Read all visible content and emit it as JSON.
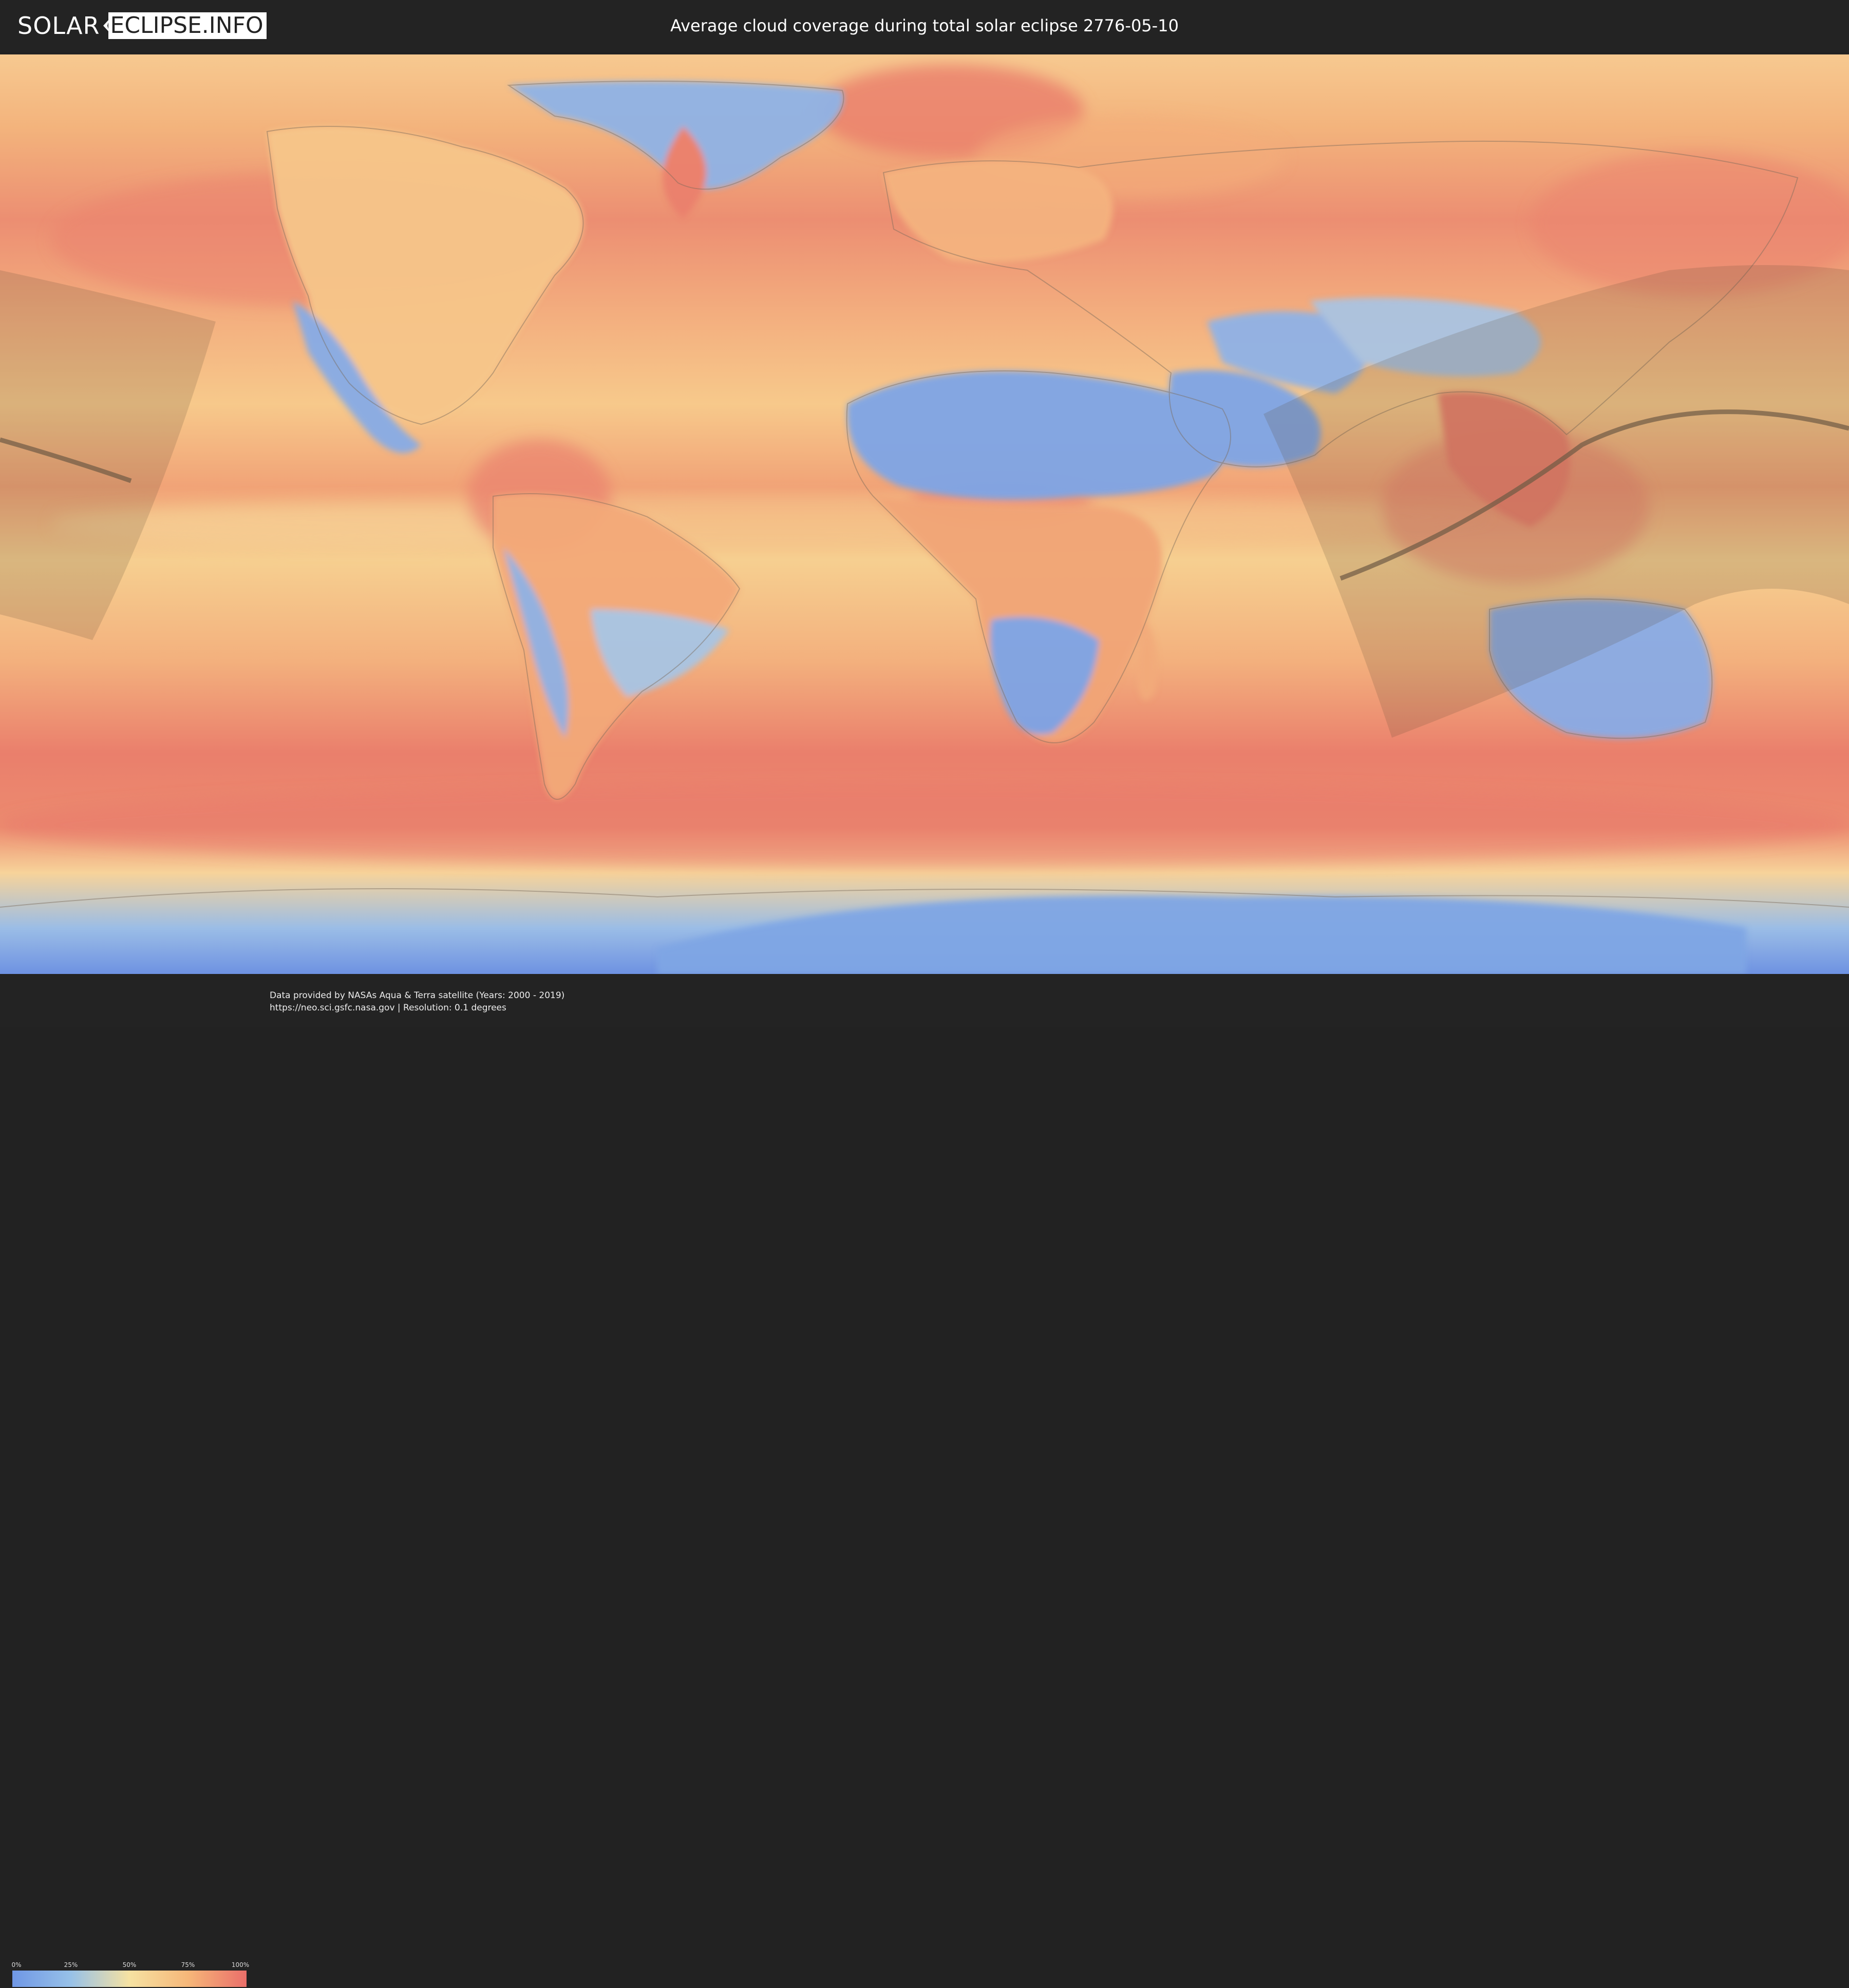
{
  "header": {
    "logo_left": "SOLAR",
    "logo_right": "ECLIPSE.INFO",
    "title": "Average cloud coverage during total solar eclipse 2776-05-10"
  },
  "legend": {
    "ticks": [
      "0%",
      "25%",
      "50%",
      "75%",
      "100%"
    ],
    "colors": [
      "#6f97e6",
      "#97c1e8",
      "#f6e2a2",
      "#f6b779",
      "#ea6f6a"
    ]
  },
  "footer": {
    "line1": "Data provided by NASAs Aqua & Terra satellite (Years: 2000 - 2019)",
    "line2": "https://neo.sci.gsfc.nasa.gov | Resolution: 0.1 degrees"
  },
  "map_colors": {
    "ocean_cloudy": "#ec8a6e",
    "ocean_mid": "#f6c184",
    "clear_land": "#7ea5e6",
    "eclipse_overlay": "#5b4a34"
  }
}
